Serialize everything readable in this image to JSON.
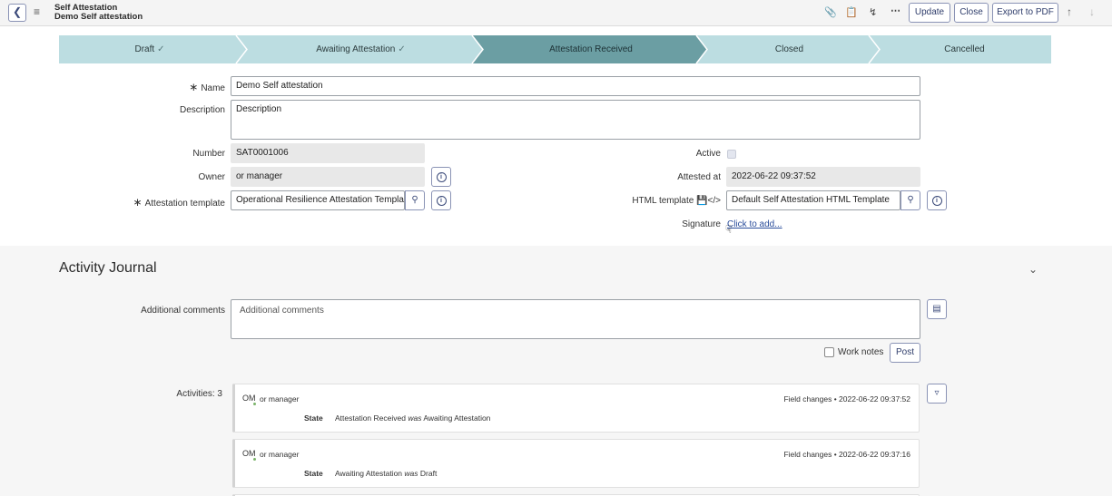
{
  "header": {
    "back_icon": "chevron-left-icon",
    "menu_icon": "hamburger-icon",
    "title_line1": "Self Attestation",
    "title_line2": "Demo Self attestation",
    "icons": [
      "paperclip-icon",
      "clipboard-icon",
      "activity-icon",
      "more-icon"
    ],
    "buttons": {
      "update": "Update",
      "close": "Close",
      "export": "Export to PDF"
    }
  },
  "progress": {
    "stages": [
      {
        "label": "Draft",
        "state": "done"
      },
      {
        "label": "Awaiting Attestation",
        "state": "done"
      },
      {
        "label": "Attestation Received",
        "state": "active"
      },
      {
        "label": "Closed",
        "state": "pending"
      },
      {
        "label": "Cancelled",
        "state": "pending"
      }
    ]
  },
  "form": {
    "name_label": "Name",
    "name_value": "Demo Self attestation",
    "description_label": "Description",
    "description_value": "Description",
    "number_label": "Number",
    "number_value": "SAT0001006",
    "owner_label": "Owner",
    "owner_value": "or manager",
    "template_label": "Attestation template",
    "template_value": "Operational Resilience Attestation Template",
    "active_label": "Active",
    "active_checked": true,
    "attested_label": "Attested at",
    "attested_value": "2022-06-22 09:37:52",
    "html_template_label": "HTML template",
    "html_template_value": "Default Self Attestation HTML Template",
    "signature_label": "Signature",
    "signature_link": "Click to add..."
  },
  "journal": {
    "title": "Activity Journal",
    "comments_label": "Additional comments",
    "comments_placeholder": "Additional comments",
    "work_notes_label": "Work notes",
    "post_label": "Post",
    "activities_label": "Activities: 3",
    "entries": [
      {
        "initials": "OM",
        "user": "or manager",
        "meta": "Field changes  •  2022-06-22 09:37:52",
        "field": "State",
        "new_value": "Attestation Received",
        "was": "was",
        "old_value": "Awaiting Attestation"
      },
      {
        "initials": "OM",
        "user": "or manager",
        "meta": "Field changes  •  2022-06-22 09:37:16",
        "field": "State",
        "new_value": "Awaiting Attestation",
        "was": "was",
        "old_value": "Draft"
      }
    ]
  }
}
